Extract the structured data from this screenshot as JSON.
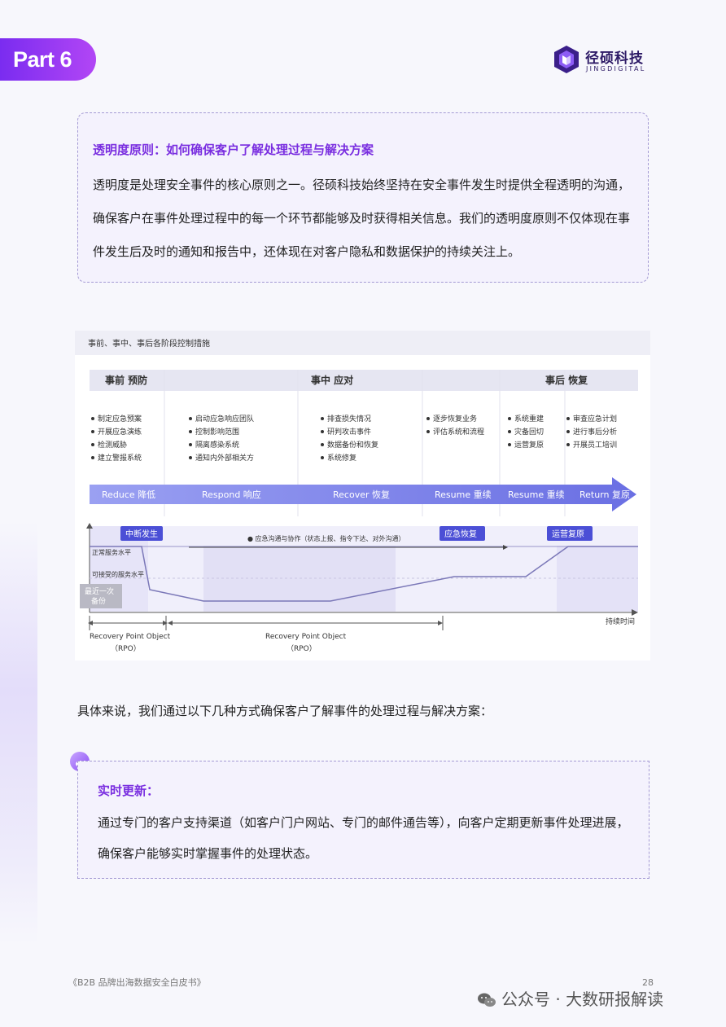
{
  "header": {
    "part_label": "Part 6"
  },
  "logo": {
    "name_cn": "径硕科技",
    "name_en": "JINGDIGITAL"
  },
  "principle_box": {
    "heading": "透明度原则：如何确保客户了解处理过程与解决方案",
    "body": "透明度是处理安全事件的核心原则之一。径硕科技始终坚持在安全事件发生时提供全程透明的沟通，确保客户在事件处理过程中的每一个环节都能够及时获得相关信息。我们的透明度原则不仅体现在事件发生后及时的通知和报告中，还体现在对客户隐私和数据保护的持续关注上。"
  },
  "figure": {
    "title": "事前、事中、事后各阶段控制措施",
    "phases": [
      "事前 预防",
      "事中 应对",
      "事后 恢复"
    ],
    "measures": [
      [
        "制定应急预案",
        "开展应急演练",
        "检测威胁",
        "建立警报系统"
      ],
      [
        "启动应急响应团队",
        "控制影响范围",
        "隔离感染系统",
        "通知内外部相关方"
      ],
      [
        "排查损失情况",
        "研判攻击事件",
        "数据备份和恢复",
        "系统修复"
      ],
      [
        "逐步恢复业务",
        "评估系统和流程"
      ],
      [
        "系统重建",
        "灾备回切",
        "运营复原"
      ],
      [
        "审查应急计划",
        "进行事后分析",
        "开展员工培训"
      ]
    ],
    "arrow_stages": [
      "Reduce 降低",
      "Respond 响应",
      "Recover 恢复",
      "Resume 重续",
      "Resume 重续",
      "Return 复原"
    ],
    "markers": {
      "incident": "中断发生",
      "emergency_recovery": "应急恢复",
      "ops_restore": "运营复原"
    },
    "communication_note": "● 应急沟通与协作（状态上报、指令下达、对外沟通）",
    "levels": {
      "normal": "正常服务水平",
      "acceptable": "可接受的服务水平"
    },
    "backup_label": [
      "最近一次",
      "备份"
    ],
    "time_axis": "持续时间",
    "rpo_left": [
      "Recovery Point Object",
      "（RPO）"
    ],
    "rpo_right": [
      "Recovery Point Object",
      "（RPO）"
    ]
  },
  "intro_text": "具体来说，我们通过以下几种方式确保客户了解事件的处理过程与解决方案：",
  "update_box": {
    "heading": "实时更新：",
    "body": "通过专门的客户支持渠道（如客户门户网站、专门的邮件通告等），向客户定期更新事件处理进展，确保客户能够实时掌握事件的处理状态。"
  },
  "footer": {
    "title": "《B2B 品牌出海数据安全白皮书》",
    "page": "28",
    "watermark": "公众号 · 大数研报解读"
  },
  "colors": {
    "brand_purple": "#7a2fe0",
    "arrow_blue": "#7b7fe6",
    "marker_blue": "#4b4fd6"
  }
}
